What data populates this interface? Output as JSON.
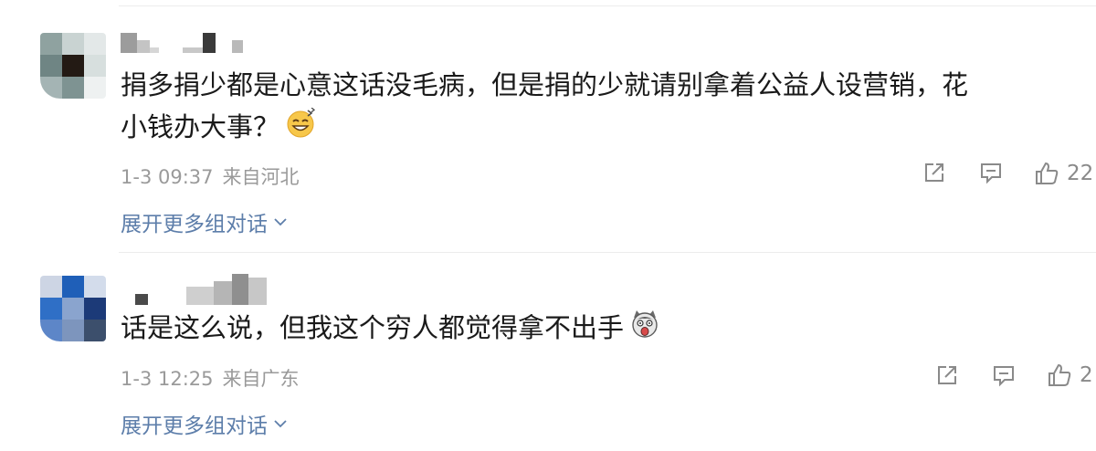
{
  "comments": [
    {
      "text_line1": "捐多捐少都是心意这话没毛病，但是捐的少就请别拿着公益人设营销，花",
      "text_line2": "小钱办大事？",
      "emoji_icon": "grinning-sweat-face",
      "date": "1-3 09:37",
      "location": "来自河北",
      "like_count": "22",
      "expand_label": "展开更多组对话"
    },
    {
      "text_line1": "话是这么说，但我这个穷人都觉得拿不出手",
      "emoji_icon": "shocked-dog-face",
      "date": "1-3 12:25",
      "location": "来自广东",
      "like_count": "2",
      "expand_label": "展开更多组对话"
    }
  ],
  "colors": {
    "text": "#1a1a1a",
    "meta": "#9a9a9a",
    "link": "#5d7eaa",
    "icon": "#8a8a8a",
    "divider": "#ececec"
  }
}
